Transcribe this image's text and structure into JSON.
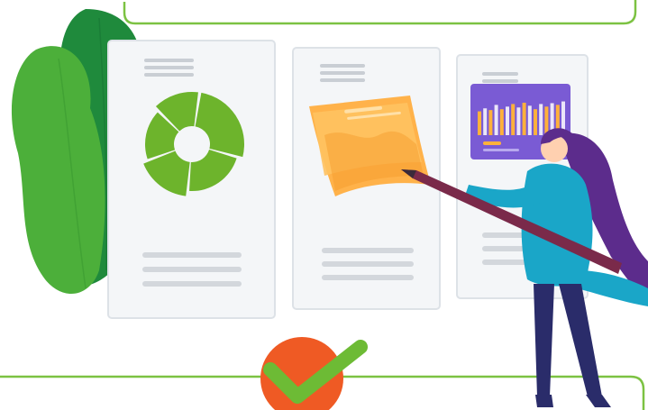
{
  "illustration": {
    "colors": {
      "frame_line": "#7cc242",
      "leaf_light": "#4caf3a",
      "leaf_dark": "#1f8a3c",
      "panel_bg": "#f4f6f8",
      "panel_border": "#dde2e7",
      "placeholder_line": "#c9ced4",
      "donut_green": "#6db42c",
      "sticky_note": "#ffb24a",
      "bar_panel": "#7a5bd4",
      "bar_fill": "#ffb13b",
      "woman_top": "#1aa6c8",
      "woman_pants": "#2a2c6a",
      "woman_hair": "#5c2c8c",
      "pencil": "#7a2a4a",
      "check_badge": "#ef5a24",
      "check_mark": "#6dbb35"
    },
    "donut_segments": [
      0.27,
      0.22,
      0.18,
      0.18,
      0.15
    ],
    "bar_levels": [
      0.55,
      0.62,
      0.58,
      0.7,
      0.6,
      0.66,
      0.72,
      0.64,
      0.75,
      0.68,
      0.6,
      0.72,
      0.66,
      0.74,
      0.7,
      0.78
    ]
  }
}
